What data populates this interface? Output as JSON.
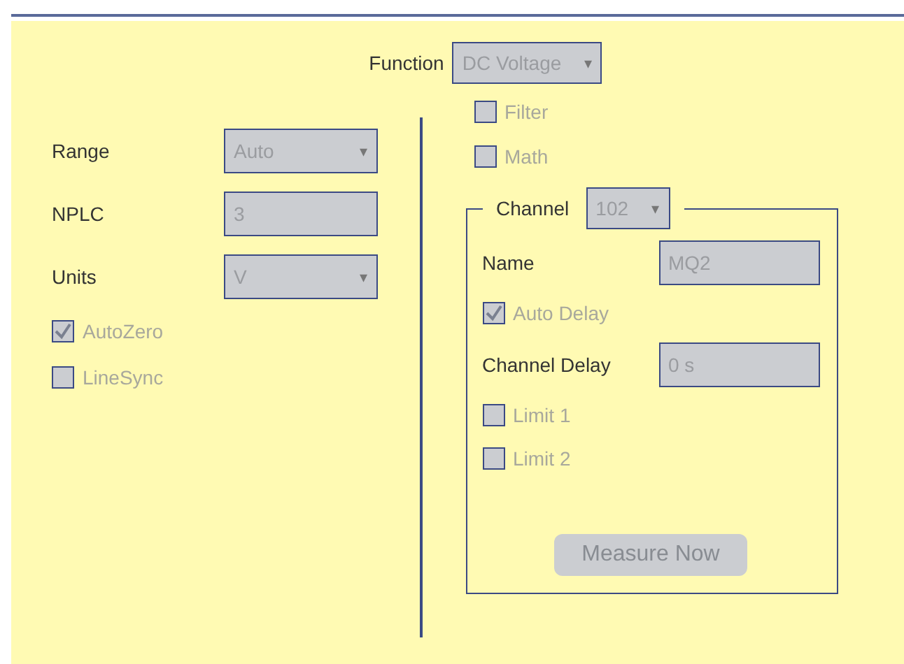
{
  "function": {
    "label": "Function",
    "value": "DC Voltage",
    "caret": "▾",
    "disabled": true
  },
  "left": {
    "fields": [
      {
        "kind": "select",
        "label": "Range",
        "value": "Auto",
        "caret": "▾",
        "disabled": true
      },
      {
        "kind": "input",
        "label": "NPLC",
        "value": "3",
        "disabled": true
      },
      {
        "kind": "select",
        "label": "Units",
        "value": "V",
        "caret": "▾",
        "disabled": true
      }
    ],
    "checkboxes": [
      {
        "label": "AutoZero",
        "checked": true,
        "disabled": true
      },
      {
        "label": "LineSync",
        "checked": false,
        "disabled": true
      }
    ]
  },
  "right": {
    "checkboxes": [
      {
        "label": "Filter",
        "checked": false,
        "disabled": true
      },
      {
        "label": "Math",
        "checked": false,
        "disabled": true
      }
    ],
    "channel": {
      "label": "Channel",
      "value": "102",
      "caret": "▾",
      "disabled": true,
      "rows": [
        {
          "kind": "input",
          "label": "Name",
          "value": "MQ2",
          "disabled": true
        },
        {
          "kind": "checkbox",
          "label": "Auto Delay",
          "checked": true,
          "disabled": true
        },
        {
          "kind": "input",
          "label": "Channel Delay",
          "value": "0 s",
          "disabled": true
        },
        {
          "kind": "checkbox",
          "label": "Limit 1",
          "checked": false,
          "disabled": true
        },
        {
          "kind": "checkbox",
          "label": "Limit 2",
          "checked": false,
          "disabled": true
        }
      ],
      "button": {
        "label": "Measure Now",
        "disabled": true
      }
    }
  }
}
